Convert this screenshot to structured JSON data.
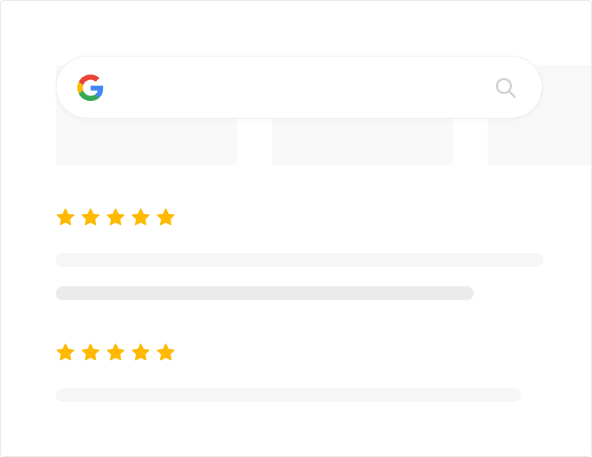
{
  "search": {
    "logo_icon": "google-g-icon",
    "search_icon": "search-icon",
    "value": ""
  },
  "colors": {
    "star": "#FFB900",
    "google_blue": "#4285F4",
    "google_red": "#EA4335",
    "google_yellow": "#FBBC05",
    "google_green": "#34A853",
    "search_icon": "#cfcfcf",
    "placeholder_light": "#f6f6f6",
    "placeholder_dark": "#ebebeb"
  },
  "reviews": [
    {
      "rating": 5,
      "max_rating": 5
    },
    {
      "rating": 5,
      "max_rating": 5
    }
  ]
}
